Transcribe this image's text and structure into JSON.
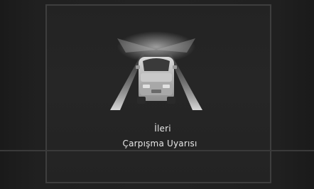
{
  "screen": {
    "illustration_icon": "car-forward-collision-icon",
    "title_line1": "İleri",
    "title_line2": "Çarpışma Uyarısı",
    "colors": {
      "background": "#222222",
      "frame_border": "#3e3e3e",
      "text": "#e8e8e8"
    }
  }
}
